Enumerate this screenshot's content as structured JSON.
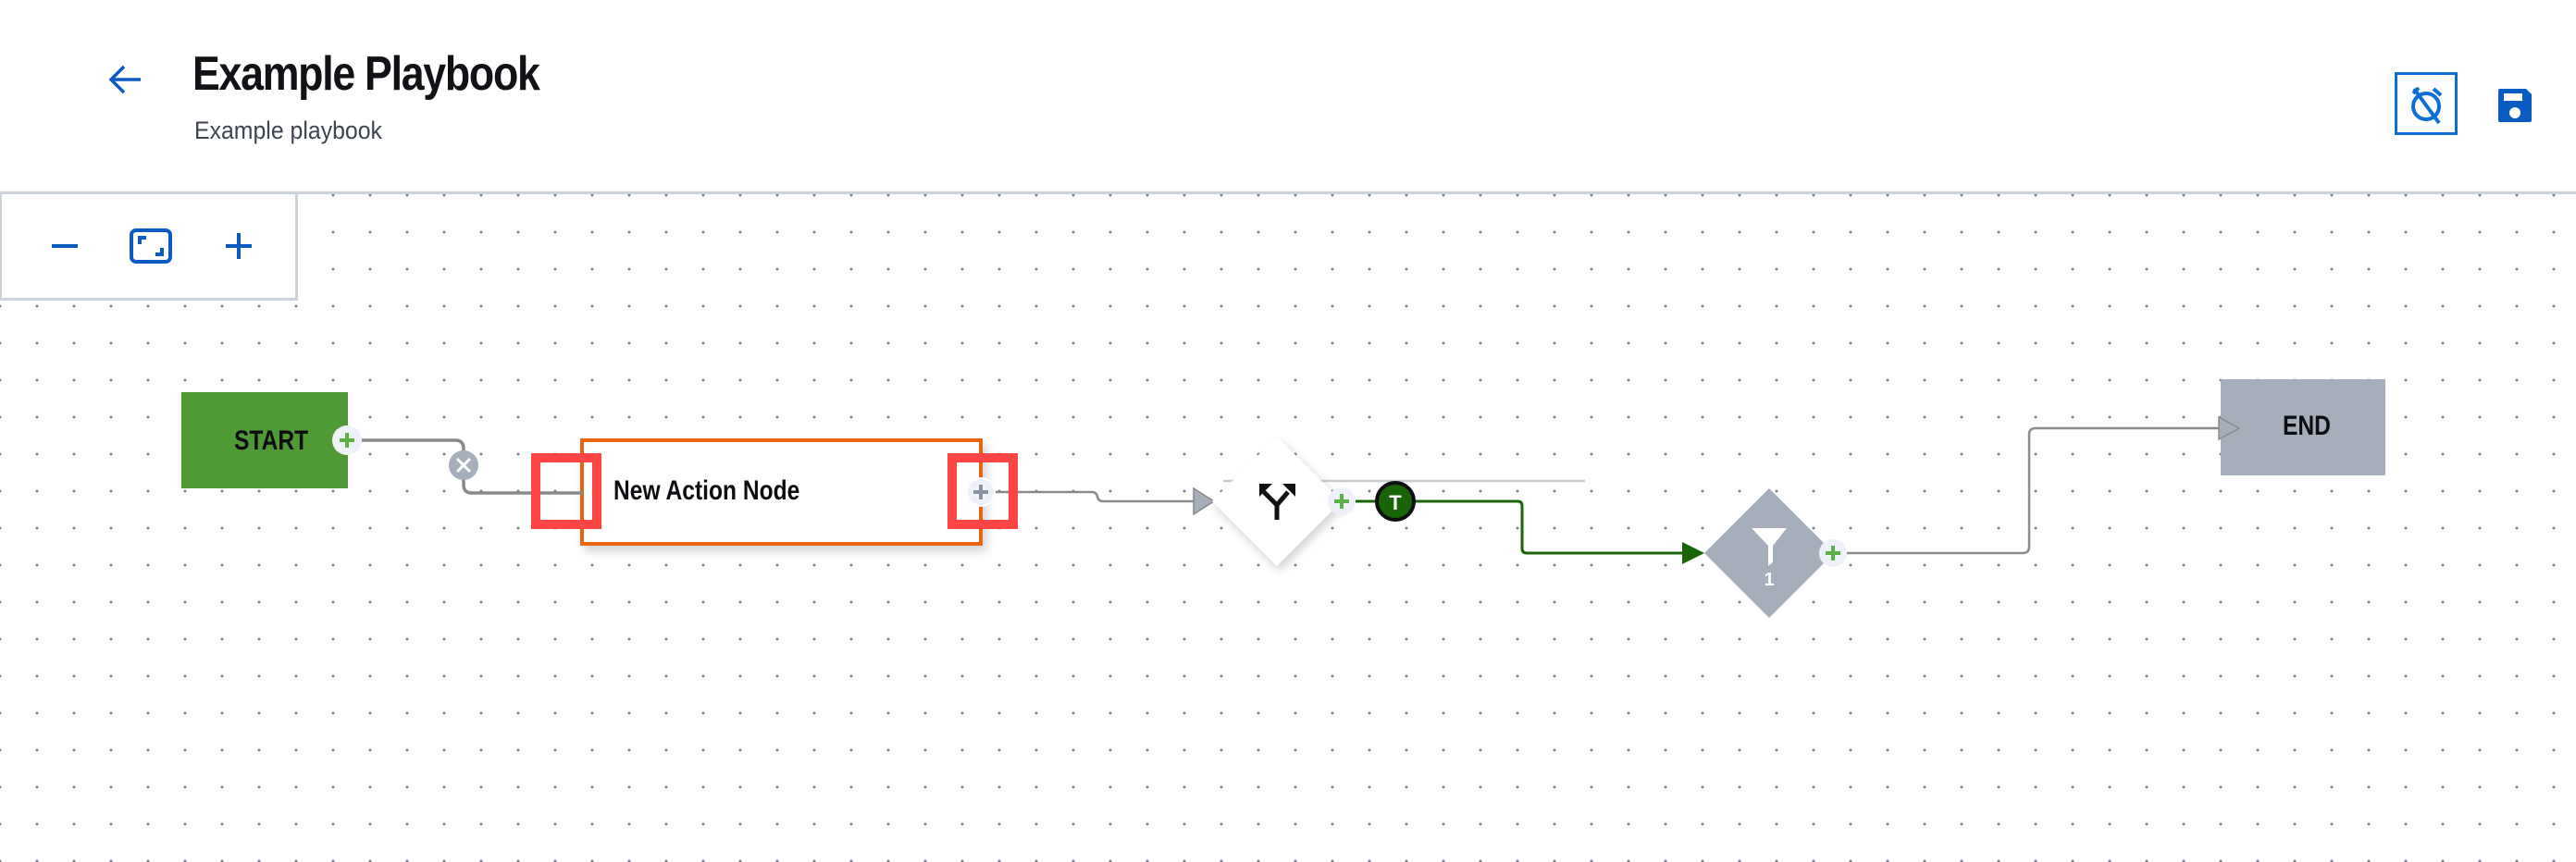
{
  "header": {
    "back_icon": "arrow-left-icon",
    "title": "Example Playbook",
    "subtitle": "Example playbook",
    "actions": [
      {
        "name": "timer-off",
        "icon": "timer-off-icon"
      },
      {
        "name": "save",
        "icon": "save-icon"
      }
    ]
  },
  "zoom_controls": {
    "zoom_out_icon": "minus-icon",
    "fit_icon": "fit-screen-icon",
    "zoom_in_icon": "plus-icon"
  },
  "colors": {
    "accent": "#0b5cc2",
    "start": "#4f9a34",
    "end": "#a6aebc",
    "action_border": "#e8650f",
    "highlight": "#ff4444",
    "true_branch": "#1a6408",
    "edge": "#8a8a8a"
  },
  "flow": {
    "start": {
      "label": "START"
    },
    "action": {
      "label": "New Action Node"
    },
    "decision": {
      "icon": "split-arrows-icon"
    },
    "true_badge": {
      "label": "T"
    },
    "filter": {
      "icon": "filter-icon",
      "count": "1"
    },
    "end": {
      "label": "END"
    }
  }
}
